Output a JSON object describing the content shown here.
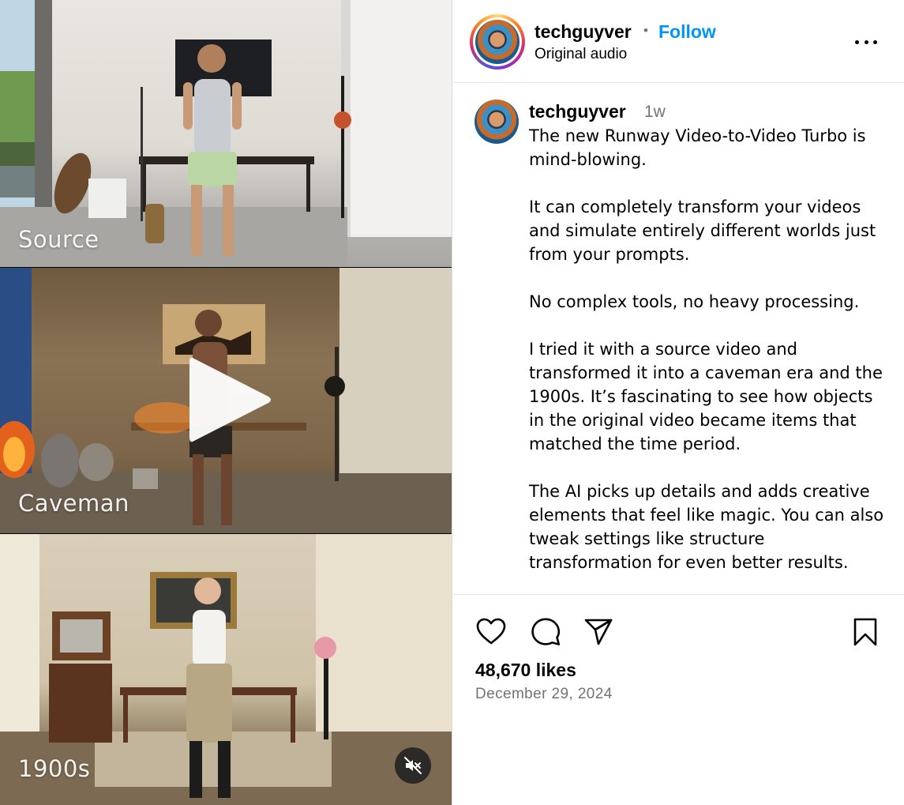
{
  "post": {
    "username": "techguyver",
    "separator": "•",
    "follow_label": "Follow",
    "audio_label": "Original audio",
    "caption_time": "1w",
    "caption": "The new Runway Video-to-Video Turbo is mind-blowing.\n\nIt can completely transform your videos and simulate entirely different worlds just from your prompts.\n\nNo complex tools, no heavy processing.\n\nI tried it with a source video and transformed it into a caveman era and the 1900s. It’s fascinating to see how objects in the original video became items that matched the time period.\n\nThe AI picks up details and adds creative elements that feel like magic. You can also tweak settings like structure transformation for even better results.",
    "likes": "48,670 likes",
    "date": "December 29, 2024"
  },
  "media": {
    "panels": [
      {
        "label": "Source"
      },
      {
        "label": "Caveman"
      },
      {
        "label": "1900s"
      }
    ]
  },
  "icons": {
    "play": "play-icon",
    "mute": "muted-speaker-icon",
    "more": "more-options-icon",
    "like": "heart-icon",
    "comment": "comment-bubble-icon",
    "share": "paper-plane-icon",
    "save": "bookmark-icon"
  },
  "colors": {
    "follow": "#0095f6",
    "secondary_text": "#737373",
    "divider": "#e6e6e6"
  }
}
